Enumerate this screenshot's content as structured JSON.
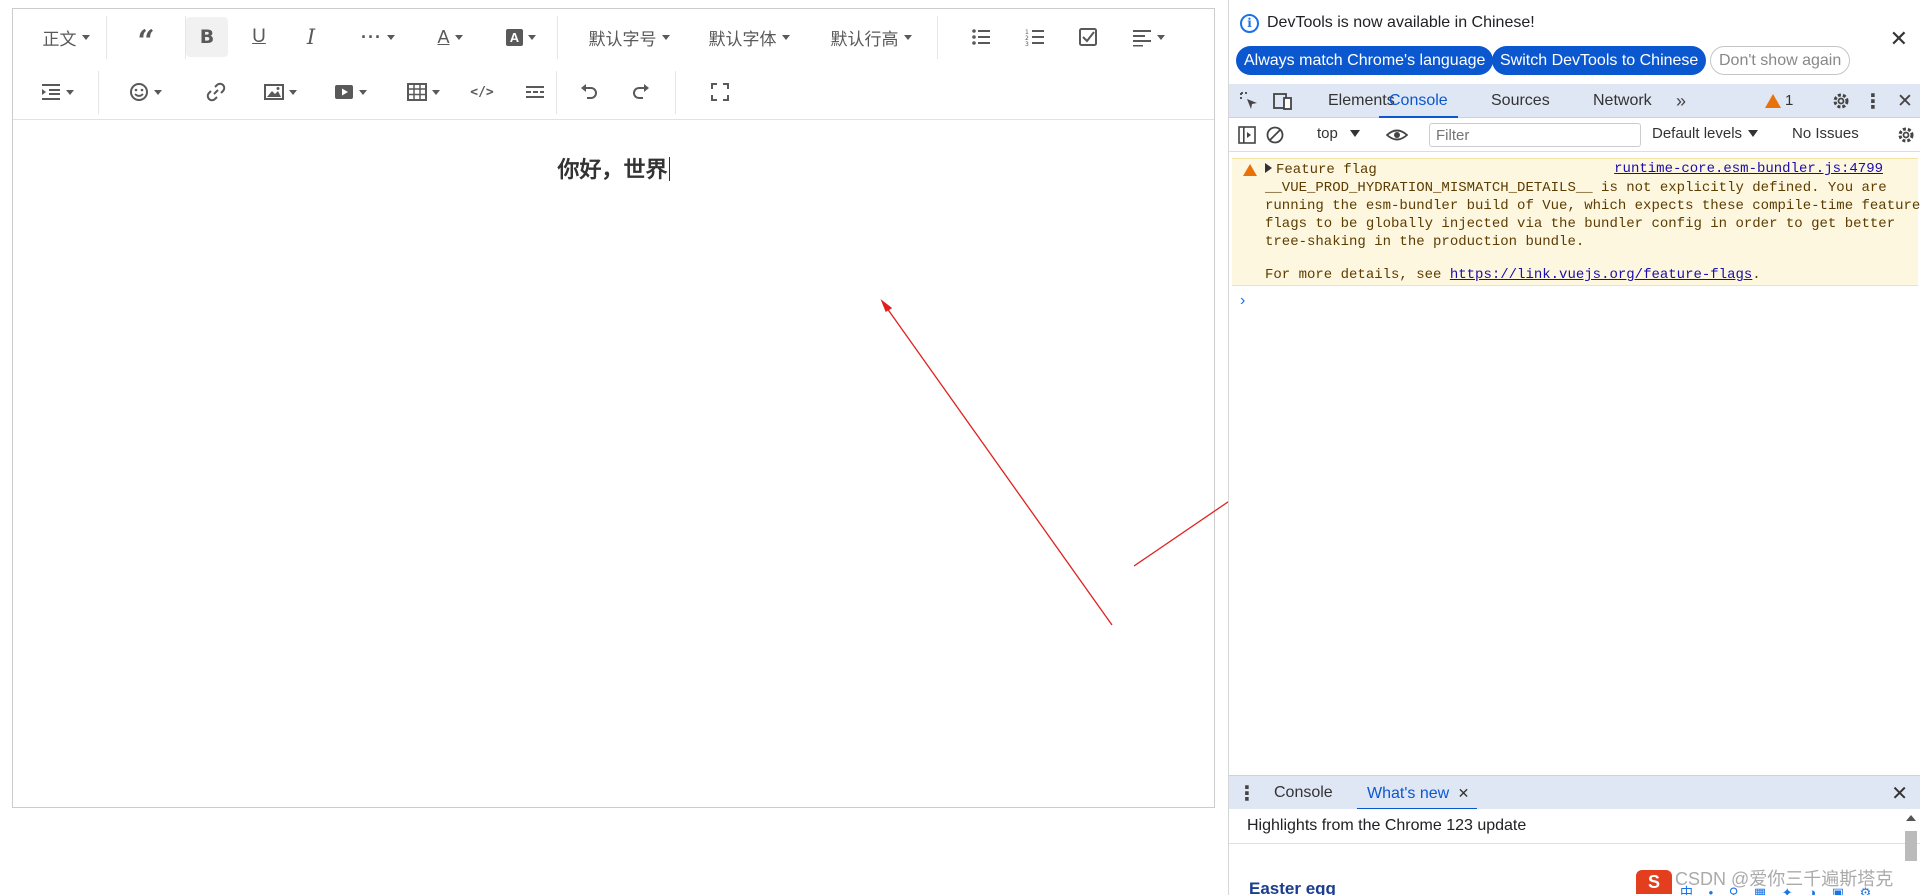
{
  "editor": {
    "toolbar": {
      "paragraph_label": "正文",
      "font_size_label": "默认字号",
      "font_family_label": "默认字体",
      "line_height_label": "默认行高"
    },
    "content": {
      "heading": "你好，世界"
    }
  },
  "annotations": {
    "arrow_color": "#e02020"
  },
  "devtools": {
    "notice": {
      "message": "DevTools is now available in Chinese!",
      "button_match": "Always match Chrome's language",
      "button_switch": "Switch DevTools to Chinese",
      "button_dismiss": "Don't show again"
    },
    "tabs": [
      "Elements",
      "Console",
      "Sources",
      "Network"
    ],
    "selected_tab": "Console",
    "warning_count": "1",
    "console_toolbar": {
      "context": "top",
      "filter_placeholder": "Filter",
      "levels": "Default levels",
      "issues": "No Issues"
    },
    "message": {
      "title": "Feature flag",
      "source": "runtime-core.esm-bundler.js:4799",
      "body": "__VUE_PROD_HYDRATION_MISMATCH_DETAILS__ is not explicitly defined. You are\nrunning the esm-bundler build of Vue, which expects these compile-time feature\nflags to be globally injected via the bundler config in order to get better\ntree-shaking in the production bundle.",
      "more_prefix": "For more details, see ",
      "more_link": "https://link.vuejs.org/feature-flags",
      "more_suffix": "."
    },
    "prompt": "›",
    "drawer": {
      "tab_console": "Console",
      "tab_whats_new": "What's new",
      "highlights": "Highlights from the Chrome 123 update",
      "easter_egg": "Easter egg"
    },
    "accent_color": "#0b57d0",
    "warning_color": "#e8710a"
  },
  "watermark": "CSDN @爱你三千遍斯塔克"
}
